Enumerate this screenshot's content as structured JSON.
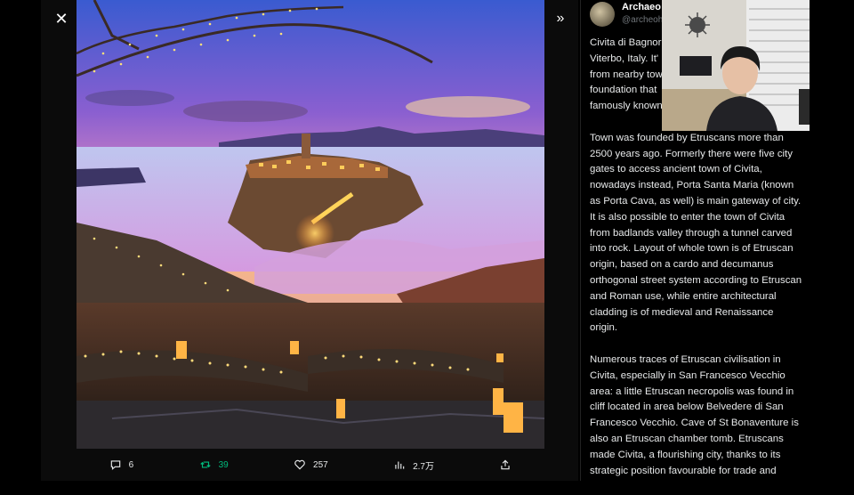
{
  "viewer": {
    "close_icon": "✕",
    "expand_icon": "»"
  },
  "actions": {
    "reply_count": "6",
    "retweet_count": "39",
    "like_count": "257",
    "views_count": "2.7万"
  },
  "post": {
    "author_name": "Archaeo",
    "author_handle": "@archeoh",
    "paragraph1": "Civita di Bagnor\nViterbo, Italy. It'\nfrom nearby tow\nfoundation that\nfamously known",
    "paragraph2": "Town was founded by Etruscans more than 2500 years ago. Formerly there were five city gates to access ancient town of Civita, nowadays instead, Porta Santa Maria (known as Porta Cava, as well) is main gateway of city. It is also possible to enter the town of Civita from badlands valley through a tunnel carved into rock. Layout of whole town is of Etruscan origin, based on a cardo and decumanus orthogonal street system according to Etruscan and Roman use, while entire architectural cladding is of medieval and Renaissance origin.",
    "paragraph3": "Numerous traces of Etruscan civilisation in Civita, especially in San Francesco Vecchio area: a little Etruscan necropolis was found in cliff located in area below Belvedere di San Francesco Vecchio. Cave of St Bonaventure is also an Etruscan chamber tomb. Etruscans made Civita, a flourishing city, thanks to its strategic position favourable for trade and"
  },
  "colors": {
    "retweet_green": "#00ba7c",
    "text": "#e7e9ea",
    "muted": "#71767b"
  },
  "icons": [
    "close-icon",
    "expand-icon",
    "reply-icon",
    "retweet-icon",
    "like-icon",
    "views-icon",
    "share-icon"
  ]
}
